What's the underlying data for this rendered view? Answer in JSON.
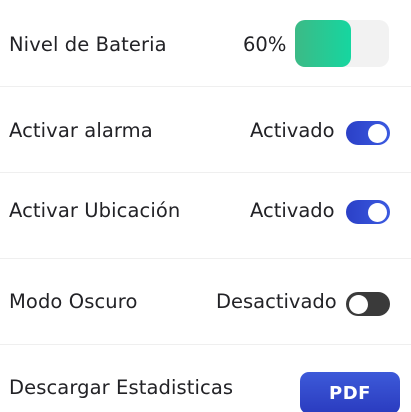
{
  "settings": {
    "battery": {
      "label": "Nivel de Bateria",
      "value_text": "60%",
      "level": 0.6,
      "fill_color": "#16d6a0"
    },
    "alarm": {
      "label": "Activar alarma",
      "status": "Activado",
      "enabled": true
    },
    "location": {
      "label": "Activar Ubicación",
      "status": "Activado",
      "enabled": true
    },
    "dark_mode": {
      "label": "Modo Oscuro",
      "status": "Desactivado",
      "enabled": false
    },
    "stats": {
      "label": "Descargar Estadisticas",
      "button_label": "PDF"
    }
  },
  "colors": {
    "toggle_on": "#2b40c7",
    "toggle_off": "#3a3a3a",
    "button": "#2a3bbf",
    "battery_fill": "#16d6a0"
  }
}
